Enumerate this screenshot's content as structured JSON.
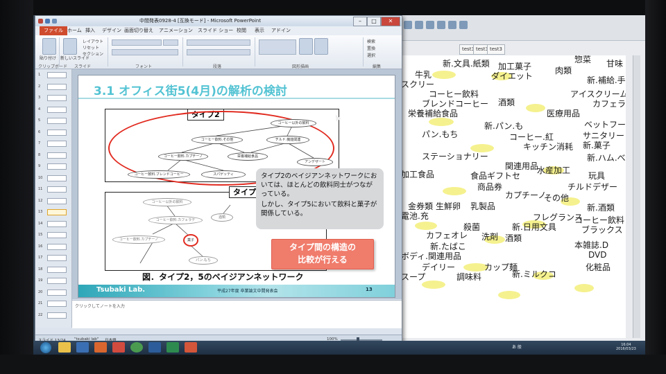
{
  "window": {
    "title": "中間発表0928-4 [互換モード] - Microsoft PowerPoint",
    "buttons": [
      "–",
      "□",
      "✕"
    ]
  },
  "ribbon": {
    "tabs": [
      "ファイル",
      "ホーム",
      "挿入",
      "デザイン",
      "画面切り替え",
      "アニメーション",
      "スライド ショー",
      "校閲",
      "表示",
      "アドイン"
    ],
    "paste_label": "貼り付け",
    "slide_labels": [
      "レイアウト",
      "リセット",
      "セクション"
    ],
    "new_slide_label": "新しいスライド",
    "find_label": "検索",
    "replace_label": "置換",
    "select_label": "選択",
    "groups": [
      "クリップボード",
      "スライド",
      "フォント",
      "段落",
      "図形描画",
      "編集"
    ]
  },
  "thumbnails": {
    "numbers": [
      "1",
      "2",
      "3",
      "4",
      "5",
      "6",
      "7",
      "8",
      "9",
      "10",
      "11",
      "12",
      "13",
      "14",
      "15",
      "16",
      "17",
      "18",
      "19",
      "20",
      "21",
      "22"
    ],
    "active_index": 12
  },
  "slide": {
    "title": "3.1 オフィス街5(4月)の解析の検討",
    "type2_label": "タイプ2",
    "type5_label": "タイプ5",
    "type2_nodes": [
      "コーヒー以外の飲料",
      "コーヒー飲料.その他",
      "チルド.機能関連",
      "コーヒー飲料.カプチーノ",
      "栄養補給食品",
      "コーヒー飲料.ブレンドコーヒー",
      "スパゲッティ",
      "アンデザート"
    ],
    "type5_nodes": [
      "コーヒー以外の飲料",
      "コーヒー飲料.カフェラテ",
      "酒類",
      "コーヒー飲料.カプチーノ",
      "菓子",
      "パン.もち"
    ],
    "callout": {
      "line1": "タイプ2のベイジアンネットワークにおいては、ほとんどの飲料同士がつながっている。",
      "line2": "しかし、タイプ5において飲料と菓子が関係している。"
    },
    "redbox": {
      "line1": "タイプ間の構造の",
      "line2": "比較が行える"
    },
    "caption": "図．タイプ2，5のベイジアンネットワーク",
    "footer": {
      "brand": "Tsubaki Lab.",
      "event": "平成27年度 卒業論文中間発表会",
      "page": "13"
    }
  },
  "notes": {
    "placeholder": "クリックしてノートを入力"
  },
  "statusbar": {
    "slide": "スライド 13/24",
    "theme": "\"tsubaki lab\"",
    "language": "日本語",
    "zoom": "100%"
  },
  "background_app": {
    "tabs": [
      "test3",
      "test3",
      "test3"
    ],
    "words": [
      "新.文具.紙類",
      "甘味",
      "加工菓子",
      "肉類",
      "惣菜",
      "牛乳",
      "ダイエット",
      "スクリー",
      "新.補給.手入",
      "コーヒー飲料",
      "アイスクリーム",
      "ブレンドコーヒー",
      "カフェラテ",
      "酒類",
      "栄養補給食品",
      "医療用品",
      "新.パン.も",
      "ベットフード",
      "コーヒー.紅",
      "パン.もち",
      "サニタリー",
      "キッチン消耗",
      "新.菓子",
      "ステーショナリー",
      "新.ハム.べ",
      "関連用品",
      "水産加工",
      "食品ギフトセ",
      "玩具",
      "加工食品",
      "商品券",
      "カプチーノ",
      "チルドデザー",
      "乳製品",
      "その他",
      "新.酒類",
      "金券類",
      "生鮮卵",
      "フレグランス",
      "コーヒー飲料",
      "ブラックス",
      "電池.充",
      "新.日用文具",
      "カフェオレ",
      "殺菌",
      "洗剤",
      "酒類",
      "新.たばこ",
      "本雑誌.D",
      "DVD",
      "化粧品",
      "ボディ.関連用品",
      "デイリー",
      "新.ミルクコ",
      "カップ麺",
      "スープ",
      "調味料"
    ]
  },
  "taskbar": {
    "tray_text": "あ 般",
    "time": "16:04",
    "date": "2016/03/23"
  }
}
